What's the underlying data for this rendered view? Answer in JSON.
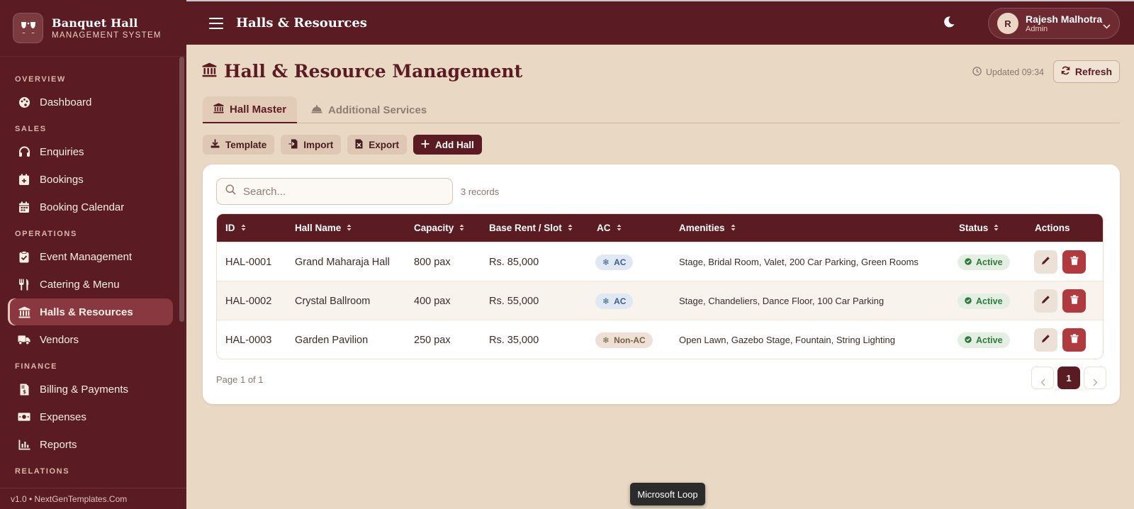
{
  "brand": {
    "title": "Banquet Hall",
    "subtitle": "MANAGEMENT SYSTEM"
  },
  "topbar": {
    "title": "Halls & Resources",
    "theme_icon": "moon-icon"
  },
  "user": {
    "initial": "R",
    "name": "Rajesh Malhotra",
    "role": "Admin"
  },
  "sidebar": {
    "sections": [
      {
        "label": "OVERVIEW",
        "items": [
          {
            "label": "Dashboard",
            "icon": "palette-icon"
          }
        ]
      },
      {
        "label": "SALES",
        "items": [
          {
            "label": "Enquiries",
            "icon": "headset-icon"
          },
          {
            "label": "Bookings",
            "icon": "calendar-plus-icon"
          },
          {
            "label": "Booking Calendar",
            "icon": "calendar-icon"
          }
        ]
      },
      {
        "label": "OPERATIONS",
        "items": [
          {
            "label": "Event Management",
            "icon": "clipboard-check-icon"
          },
          {
            "label": "Catering & Menu",
            "icon": "utensils-icon"
          },
          {
            "label": "Halls & Resources",
            "icon": "landmark-icon",
            "active": true
          },
          {
            "label": "Vendors",
            "icon": "truck-icon"
          }
        ]
      },
      {
        "label": "FINANCE",
        "items": [
          {
            "label": "Billing & Payments",
            "icon": "invoice-icon"
          },
          {
            "label": "Expenses",
            "icon": "money-icon"
          },
          {
            "label": "Reports",
            "icon": "bar-chart-icon"
          }
        ]
      },
      {
        "label": "RELATIONS",
        "items": []
      }
    ],
    "footer": "v1.0 • NextGenTemplates.Com"
  },
  "page": {
    "title": "Hall & Resource Management",
    "updated": "Updated 09:34",
    "refresh_label": "Refresh",
    "tabs": [
      {
        "label": "Hall Master",
        "active": true
      },
      {
        "label": "Additional Services",
        "active": false
      }
    ],
    "toolbar": {
      "template": "Template",
      "import": "Import",
      "export": "Export",
      "add": "Add Hall"
    },
    "search_placeholder": "Search...",
    "records": "3 records",
    "columns": [
      "ID",
      "Hall Name",
      "Capacity",
      "Base Rent / Slot",
      "AC",
      "Amenities",
      "Status",
      "Actions"
    ],
    "rows": [
      {
        "id": "HAL-0001",
        "name": "Grand Maharaja Hall",
        "capacity": "800 pax",
        "rent": "Rs. 85,000",
        "ac": "AC",
        "ac_type": "ac",
        "amenities": "Stage, Bridal Room, Valet, 200 Car Parking, Green Rooms",
        "status": "Active"
      },
      {
        "id": "HAL-0002",
        "name": "Crystal Ballroom",
        "capacity": "400 pax",
        "rent": "Rs. 55,000",
        "ac": "AC",
        "ac_type": "ac",
        "amenities": "Stage, Chandeliers, Dance Floor, 100 Car Parking",
        "status": "Active"
      },
      {
        "id": "HAL-0003",
        "name": "Garden Pavilion",
        "capacity": "250 pax",
        "rent": "Rs. 35,000",
        "ac": "Non-AC",
        "ac_type": "nonac",
        "amenities": "Open Lawn, Gazebo Stage, Fountain, String Lighting",
        "status": "Active"
      }
    ],
    "pagination": {
      "info": "Page 1 of 1",
      "current": "1"
    }
  },
  "tooltip": "Microsoft Loop",
  "colors": {
    "primary": "#5a1b22",
    "background": "#e9d8c4",
    "danger": "#b03a3e",
    "success": "#2f7a3b"
  }
}
